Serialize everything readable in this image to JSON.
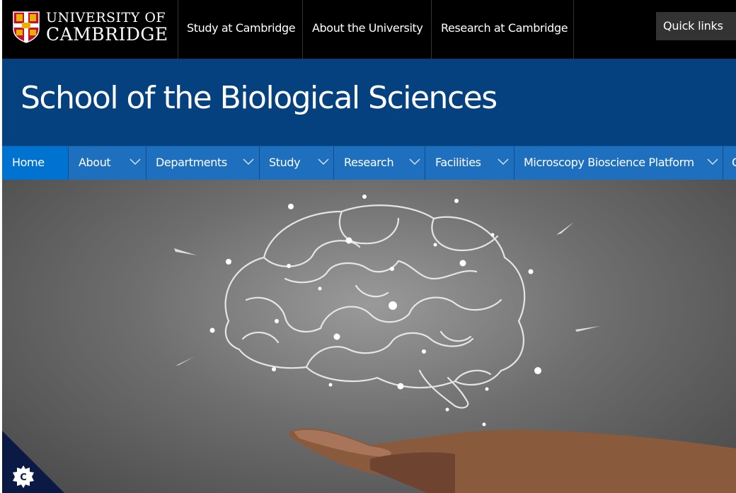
{
  "brand": {
    "line1": "UNIVERSITY OF",
    "line2": "CAMBRIDGE"
  },
  "top_links": [
    {
      "label": "Study at Cambridge"
    },
    {
      "label": "About the University"
    },
    {
      "label": "Research at Cambridge"
    }
  ],
  "quick_links": {
    "label": "Quick links"
  },
  "site_title": "School of the Biological Sciences",
  "nav": [
    {
      "label": "Home",
      "active": true
    },
    {
      "label": "About"
    },
    {
      "label": "Departments"
    },
    {
      "label": "Study"
    },
    {
      "label": "Research"
    },
    {
      "label": "Facilities"
    },
    {
      "label": "Microscopy Bioscience Platform"
    },
    {
      "label": "C"
    }
  ],
  "icons": {
    "crest": "university-crest-icon",
    "dropdown": "chevron-down-icon",
    "cookie": "cookie-settings-icon"
  },
  "colors": {
    "topbar": "#000000",
    "banner": "#05407f",
    "nav": "#1f6fbf",
    "nav_active": "#0072cf"
  }
}
